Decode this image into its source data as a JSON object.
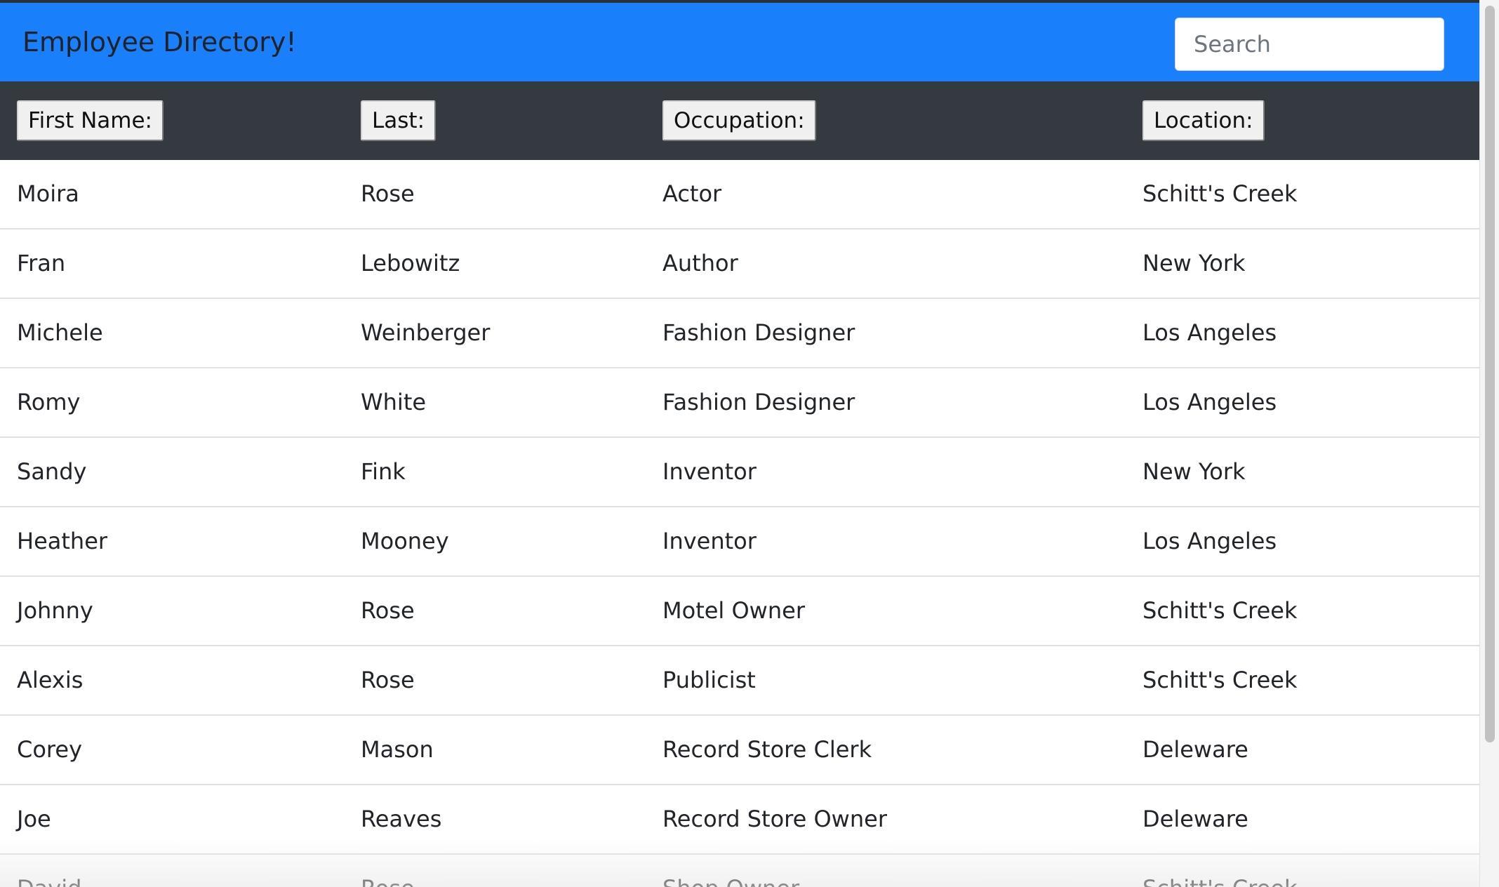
{
  "header": {
    "title": "Employee Directory!",
    "search_placeholder": "Search"
  },
  "columns": [
    "First Name:",
    "Last:",
    "Occupation:",
    "Location:"
  ],
  "rows": [
    {
      "first": "Moira",
      "last": "Rose",
      "occupation": "Actor",
      "location": "Schitt's Creek"
    },
    {
      "first": "Fran",
      "last": "Lebowitz",
      "occupation": "Author",
      "location": "New York"
    },
    {
      "first": "Michele",
      "last": "Weinberger",
      "occupation": "Fashion Designer",
      "location": "Los Angeles"
    },
    {
      "first": "Romy",
      "last": "White",
      "occupation": "Fashion Designer",
      "location": "Los Angeles"
    },
    {
      "first": "Sandy",
      "last": "Fink",
      "occupation": "Inventor",
      "location": "New York"
    },
    {
      "first": "Heather",
      "last": "Mooney",
      "occupation": "Inventor",
      "location": "Los Angeles"
    },
    {
      "first": "Johnny",
      "last": "Rose",
      "occupation": "Motel Owner",
      "location": "Schitt's Creek"
    },
    {
      "first": "Alexis",
      "last": "Rose",
      "occupation": "Publicist",
      "location": "Schitt's Creek"
    },
    {
      "first": "Corey",
      "last": "Mason",
      "occupation": "Record Store Clerk",
      "location": "Deleware"
    },
    {
      "first": "Joe",
      "last": "Reaves",
      "occupation": "Record Store Owner",
      "location": "Deleware"
    },
    {
      "first": "David",
      "last": "Rose",
      "occupation": "Shop Owner",
      "location": "Schitt's Creek"
    }
  ],
  "colors": {
    "navbar": "#1a7ffb",
    "table_header": "#343a40",
    "row_divider": "#dee2e6"
  }
}
